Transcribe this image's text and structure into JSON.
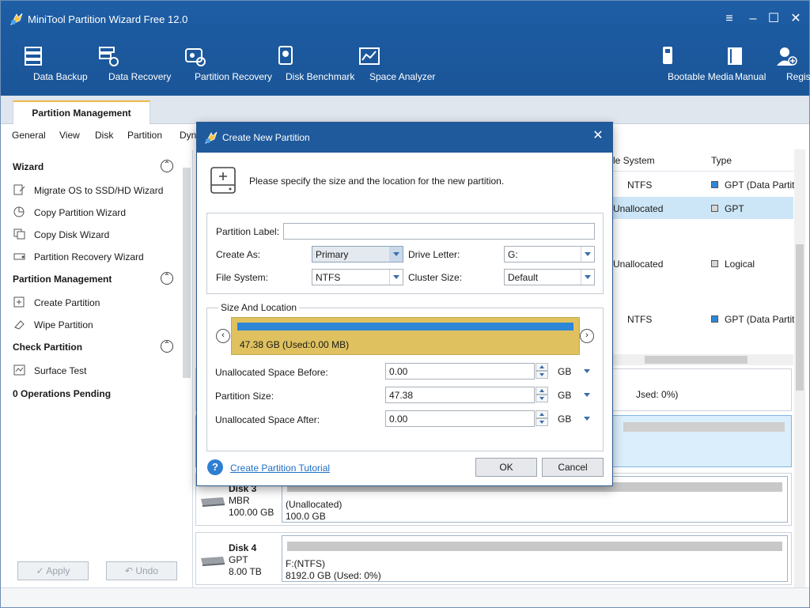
{
  "window": {
    "title": "MiniTool Partition Wizard Free 12.0"
  },
  "toolbar": {
    "left": [
      {
        "label": "Data Backup",
        "icon": "data-backup-icon"
      },
      {
        "label": "Data Recovery",
        "icon": "data-recovery-icon"
      },
      {
        "label": "Partition Recovery",
        "icon": "partition-recovery-icon"
      },
      {
        "label": "Disk Benchmark",
        "icon": "disk-benchmark-icon"
      },
      {
        "label": "Space Analyzer",
        "icon": "space-analyzer-icon"
      }
    ],
    "right": [
      {
        "label": "Bootable Media",
        "icon": "usb-icon"
      },
      {
        "label": "Manual",
        "icon": "book-icon"
      },
      {
        "label": "Register",
        "icon": "user-add-icon"
      }
    ]
  },
  "tabs": {
    "active": "Partition Management"
  },
  "menu": [
    "General",
    "View",
    "Disk",
    "Partition",
    "Dyn"
  ],
  "sidebar": {
    "wizard": {
      "title": "Wizard",
      "items": [
        "Migrate OS to SSD/HD Wizard",
        "Copy Partition Wizard",
        "Copy Disk Wizard",
        "Partition Recovery Wizard"
      ]
    },
    "partition_management": {
      "title": "Partition Management",
      "items": [
        "Create Partition",
        "Wipe Partition"
      ]
    },
    "check_partition": {
      "title": "Check Partition",
      "items": [
        "Surface Test"
      ]
    },
    "pending": "0 Operations Pending",
    "apply": "Apply",
    "undo": "Undo"
  },
  "grid": {
    "col_fs": "le System",
    "col_type": "Type",
    "rows": [
      {
        "fs": "NTFS",
        "type": "GPT (Data Partit"
      },
      {
        "fs": "Unallocated",
        "type": "GPT"
      },
      {
        "fs": "Unallocated",
        "type": "Logical"
      },
      {
        "fs": "NTFS",
        "type": "GPT (Data Partit"
      }
    ]
  },
  "disks": {
    "used_text": "Jsed: 0%)",
    "disk3": {
      "name": "Disk 3",
      "scheme": "MBR",
      "size": "100.00 GB",
      "part_label": "(Unallocated)",
      "part_size": "100.0 GB"
    },
    "disk4": {
      "name": "Disk 4",
      "scheme": "GPT",
      "size": "8.00 TB",
      "part_label": "F:(NTFS)",
      "part_size": "8192.0 GB (Used: 0%)"
    }
  },
  "dialog": {
    "title": "Create New Partition",
    "intro": "Please specify the size and the location for the new partition.",
    "labels": {
      "partition_label": "Partition Label:",
      "create_as": "Create As:",
      "drive_letter": "Drive Letter:",
      "file_system": "File System:",
      "cluster_size": "Cluster Size:",
      "size_location": "Size And Location",
      "before": "Unallocated Space Before:",
      "size": "Partition Size:",
      "after": "Unallocated Space After:"
    },
    "values": {
      "partition_label": "",
      "create_as": "Primary",
      "drive_letter": "G:",
      "file_system": "NTFS",
      "cluster_size": "Default",
      "bar_text": "47.38 GB (Used:0.00 MB)",
      "before": "0.00",
      "size": "47.38",
      "after": "0.00",
      "unit": "GB"
    },
    "tutorial": "Create Partition Tutorial",
    "ok": "OK",
    "cancel": "Cancel"
  },
  "colors": {
    "titlebar": "#1f5fa6",
    "accent_tab": "#f0b84c",
    "bar_fill": "#dfc15f",
    "bar_blue": "#2e86d6",
    "row_select": "#cde6f7"
  }
}
